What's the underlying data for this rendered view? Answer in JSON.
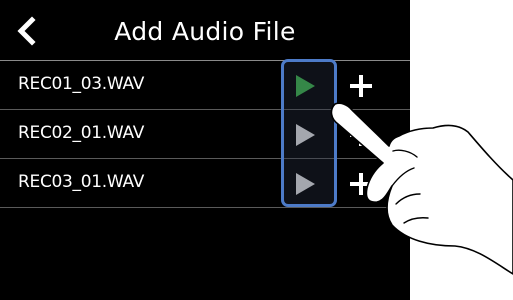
{
  "header": {
    "title": "Add Audio File",
    "back_icon": "chevron-left-icon"
  },
  "files": [
    {
      "name": "REC01_03.WAV",
      "playing": true
    },
    {
      "name": "REC02_01.WAV",
      "playing": false
    },
    {
      "name": "REC03_01.WAV",
      "playing": false
    }
  ],
  "icons": {
    "play": "play-icon",
    "add": "plus-icon",
    "hand": "hand-pointer-icon"
  },
  "colors": {
    "background": "#000000",
    "text": "#ffffff",
    "play_active": "#3cb54a",
    "play_inactive": "#e6e6e6",
    "highlight": "#4d7bc8"
  }
}
